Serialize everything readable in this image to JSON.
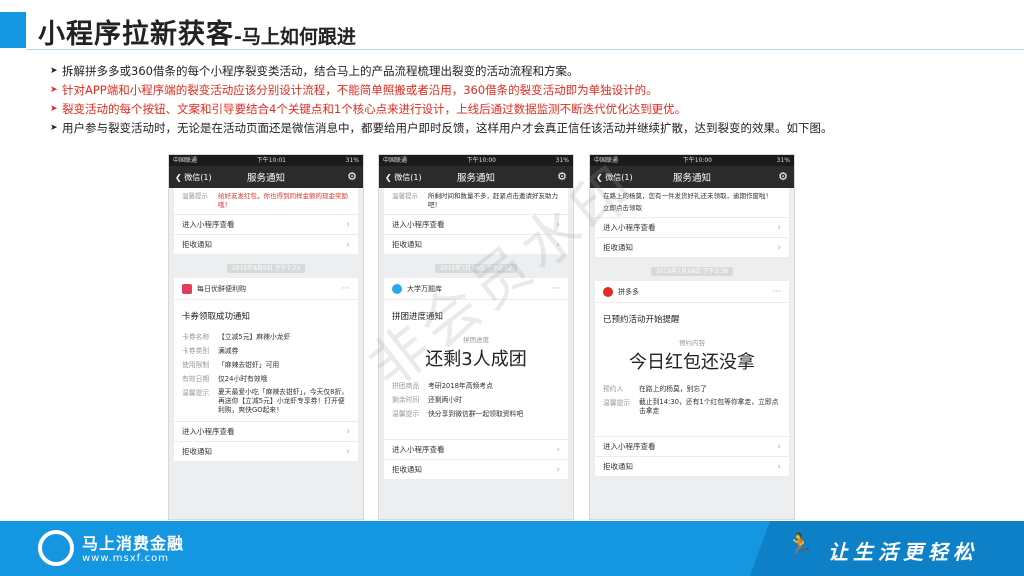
{
  "header": {
    "title": "小程序拉新获客",
    "subtitle": "-马上如何跟进"
  },
  "bullets": [
    {
      "text": "拆解拼多多或360借条的每个小程序裂变类活动，结合马上的产品流程梳理出裂变的活动流程和方案。",
      "color": "black"
    },
    {
      "text": "针对APP端和小程序端的裂变活动应该分别设计流程，不能简单照搬或者沿用，360借条的裂变活动即为单独设计的。",
      "color": "red"
    },
    {
      "text": "裂变活动的每个按钮、文案和引导要结合4个关键点和1个核心点来进行设计，上线后通过数据监测不断迭代优化达到更优。",
      "color": "red"
    },
    {
      "text": "用户参与裂变活动时，无论是在活动页面还是微信消息中，都要给用户即时反馈，这样用户才会真正信任该活动并继续扩散，达到裂变的效果。如下图。",
      "color": "black"
    }
  ],
  "common": {
    "status_left": "中国联通",
    "status_right": "31%",
    "nav_back": "微信(1)",
    "nav_title": "服务通知",
    "enter_label": "进入小程序查看",
    "reject_label": "拒收通知",
    "tip_key": "温馨提示"
  },
  "phone1": {
    "time": "下午10:01",
    "top_tip": "给好友发红包，你也得到同样金额的现金奖励哦！",
    "timestamp": "2018年8月9日 下午7:23",
    "shop": "每日优鲜便利购",
    "card_title": "卡券领取成功通知",
    "rows": [
      {
        "k": "卡券名称",
        "v": "【立减5元】麻辣小龙虾"
      },
      {
        "k": "卡券类别",
        "v": "满减券"
      },
      {
        "k": "使用限制",
        "v": "「麻辣去钳虾」可用"
      },
      {
        "k": "有效日期",
        "v": "仅24小时有效哦"
      },
      {
        "k": "温馨提示",
        "v": "夏天最爱小吃「麻辣去钳虾」，今天仅8折，再送你【立减5元】小龙虾专享券！打开便利购，爽快GO起来！"
      }
    ]
  },
  "phone2": {
    "time": "下午10:00",
    "top_tip": "所剩时间和数量不多，赶紧点击邀请好友助力吧！",
    "timestamp": "2018年7月29日 下午2:02",
    "shop": "大学万题库",
    "card_title": "拼团进度通知",
    "big_label": "拼团进度",
    "big_text": "还剩3人成团",
    "rows": [
      {
        "k": "拼团商品",
        "v": "考研2018年高频考点"
      },
      {
        "k": "剩余时间",
        "v": "还剩两小时"
      },
      {
        "k": "温馨提示",
        "v": "快分享到微信群一起领取资料吧"
      }
    ]
  },
  "phone3": {
    "time": "下午10:00",
    "top_tip": "在路上的杨莫，您有一件发货好礼还未领取，逾期作废啦！",
    "top_tip2": "立即点击领取",
    "timestamp": "2018年7月28日 下午2:38",
    "shop": "拼多多",
    "card_title": "已预约活动开始提醒",
    "big_label": "预约内容",
    "big_text": "今日红包还没拿",
    "rows": [
      {
        "k": "预约人",
        "v": "在路上的杨莫，别忘了"
      },
      {
        "k": "温馨提示",
        "v": "截止到14:30，还有1个红包等你拿走，立即点击拿走"
      }
    ]
  },
  "watermark": "非会员水印",
  "footer": {
    "brand": "马上消费金融",
    "url": "www.msxf.com",
    "slogan": "让生活更轻松"
  },
  "colors": {
    "accent": "#1596e0",
    "red_text": "#e32b1c"
  }
}
